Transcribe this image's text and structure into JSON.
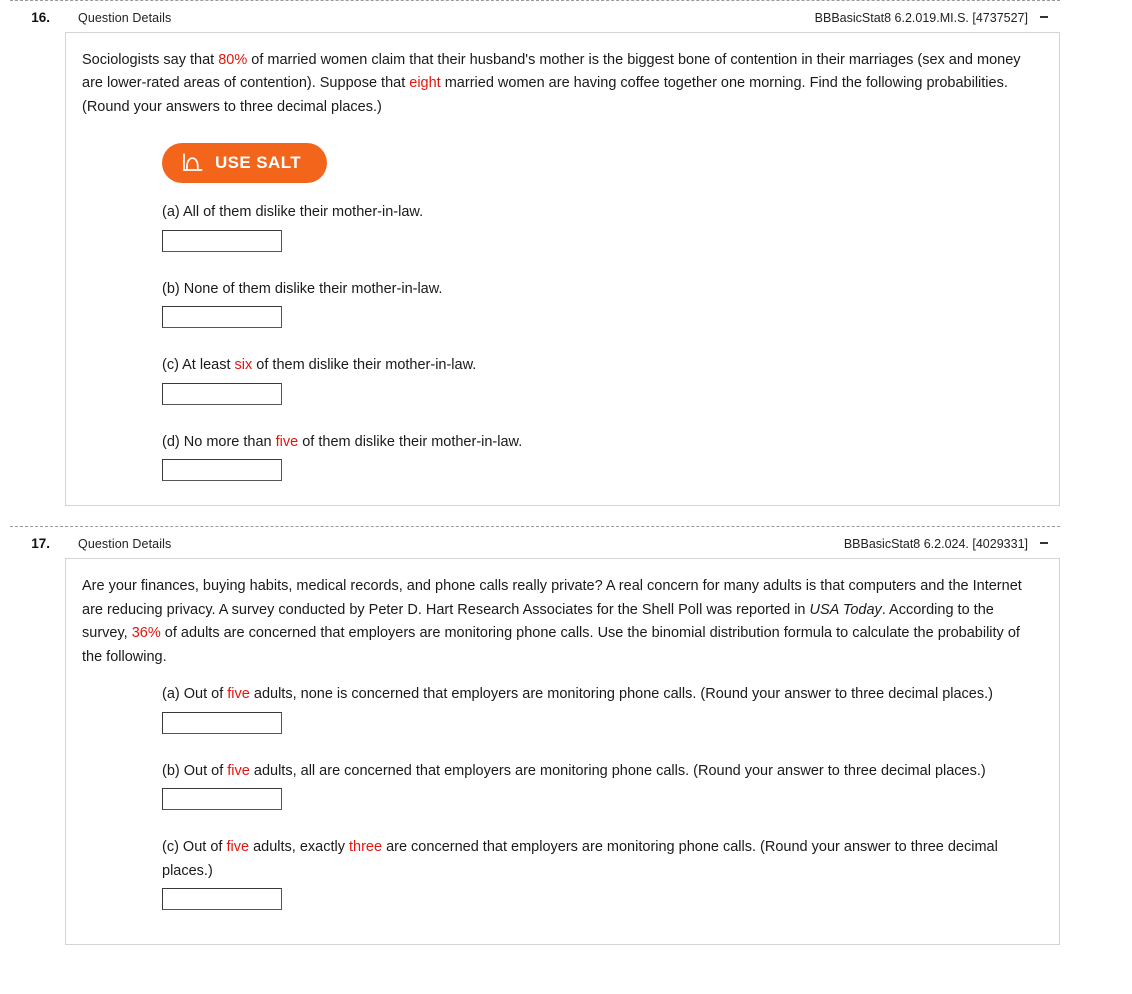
{
  "questions": [
    {
      "number": "16.",
      "details_label": "Question Details",
      "code": "BBBasicStat8 6.2.019.MI.S. [4737527]",
      "collapse_label": "-",
      "stem": {
        "part1": "Sociologists say that ",
        "hl1": "80%",
        "part2": " of married women claim that their husband's mother is the biggest bone of contention in their marriages (sex and money are lower-rated areas of contention). Suppose that ",
        "hl2": "eight",
        "part3": " married women are having coffee together one morning. Find the following probabilities. (Round your answers to three decimal places.)"
      },
      "salt": {
        "label": "USE SALT",
        "icon": "distribution-curve-icon",
        "color": "#f4651c"
      },
      "parts": [
        {
          "id": "a",
          "pre": "(a) All of them dislike their mother-in-law.",
          "hl": "",
          "post": "",
          "answer": "",
          "placeholder": ""
        },
        {
          "id": "b",
          "pre": "(b) None of them dislike their mother-in-law.",
          "hl": "",
          "post": "",
          "answer": "",
          "placeholder": ""
        },
        {
          "id": "c",
          "pre": "(c) At least ",
          "hl": "six",
          "post": " of them dislike their mother-in-law.",
          "answer": "",
          "placeholder": ""
        },
        {
          "id": "d",
          "pre": "(d) No more than ",
          "hl": "five",
          "post": " of them dislike their mother-in-law.",
          "answer": "",
          "placeholder": ""
        }
      ]
    },
    {
      "number": "17.",
      "details_label": "Question Details",
      "code": "BBBasicStat8 6.2.024. [4029331]",
      "collapse_label": "-",
      "stem": {
        "part1": "Are your finances, buying habits, medical records, and phone calls really private? A real concern for many adults is that computers and the Internet are reducing privacy. A survey conducted by Peter D. Hart Research Associates for the Shell Poll was reported in ",
        "italic": "USA Today",
        "part2": ". According to the survey, ",
        "hl1": "36%",
        "part3": " of adults are concerned that employers are monitoring phone calls. Use the binomial distribution formula to calculate the probability of the following."
      },
      "parts": [
        {
          "id": "a",
          "pre": "(a) Out of ",
          "hl": "five",
          "post": " adults, none is concerned that employers are monitoring phone calls. (Round your answer to three decimal places.)",
          "answer": "",
          "placeholder": ""
        },
        {
          "id": "b",
          "pre": "(b) Out of ",
          "hl": "five",
          "post": " adults, all are concerned that employers are monitoring phone calls. (Round your answer to three decimal places.)",
          "answer": "",
          "placeholder": ""
        },
        {
          "id": "c",
          "pre": "(c) Out of ",
          "hl": "five",
          "hl2": "three",
          "mid": " adults, exactly ",
          "post": " are concerned that employers are monitoring phone calls. (Round your answer to three decimal places.)",
          "answer": "",
          "placeholder": ""
        }
      ]
    }
  ],
  "colors": {
    "highlight": "#e8140c",
    "salt_orange": "#f4651c",
    "card_border": "#d4d4d4"
  }
}
